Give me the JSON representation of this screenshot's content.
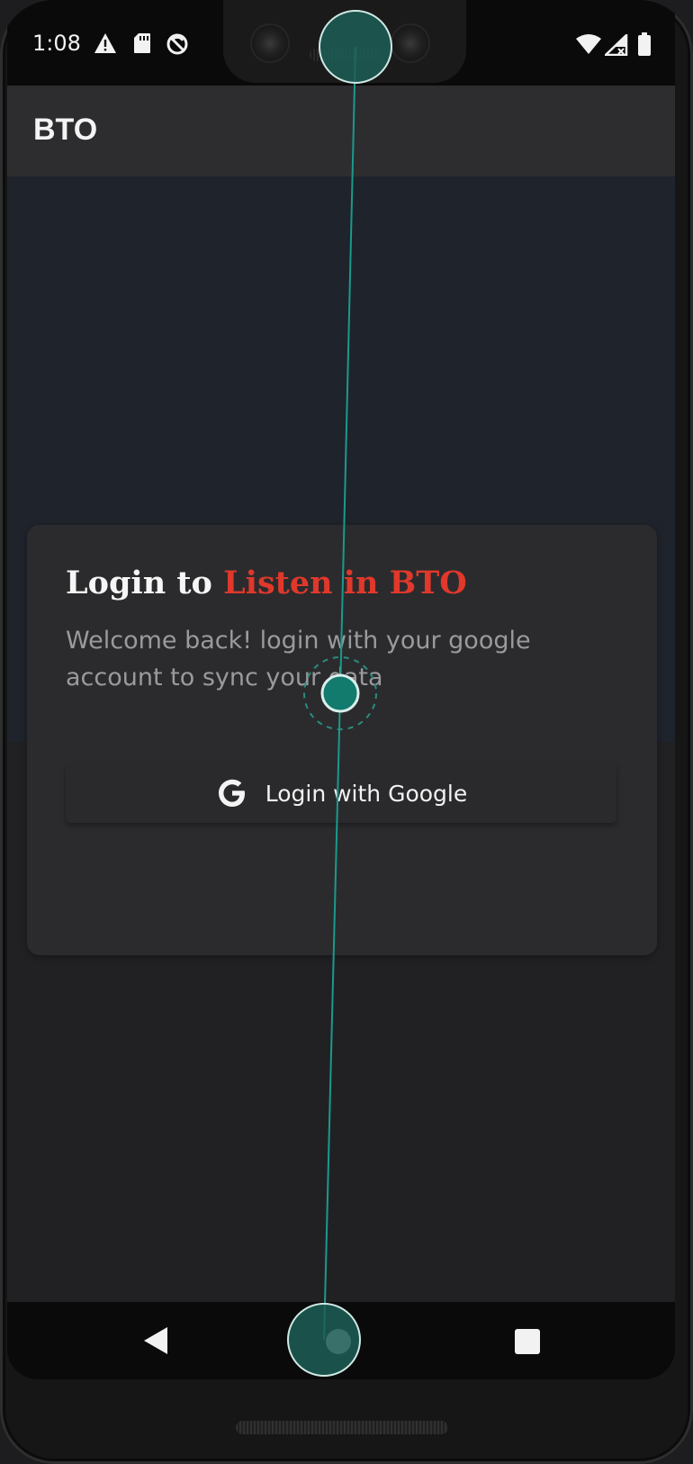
{
  "status_bar": {
    "time": "1:08",
    "left_icons": [
      "alert-icon",
      "sd-card-icon",
      "sync-disabled-icon"
    ],
    "right_icons": [
      "wifi-icon",
      "cellular-no-signal-icon",
      "battery-icon"
    ]
  },
  "app_bar": {
    "title": "BTO"
  },
  "login_card": {
    "title_prefix": "Login to ",
    "title_accent": "Listen in BTO",
    "subtitle": "Welcome back! login with your google account to sync your data",
    "google_button_label": "Login with Google",
    "google_icon": "google-g-icon"
  },
  "nav_bar": {
    "buttons": [
      "back",
      "home",
      "recents"
    ]
  },
  "colors": {
    "accent": "#e0382b",
    "card_background": "#2b2b2d",
    "app_bar": "#2d2d2f",
    "gesture_teal": "#1a7a70"
  }
}
